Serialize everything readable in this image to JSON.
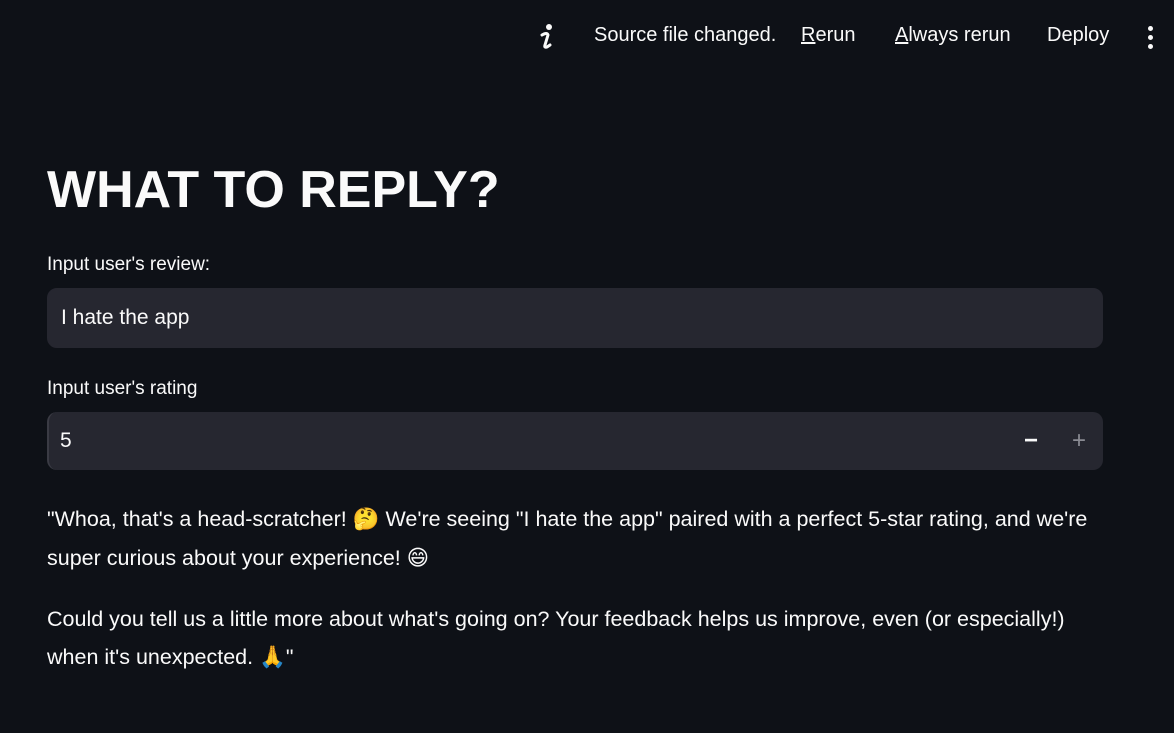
{
  "header": {
    "status_icon": "info-icon",
    "status_text": "Source file changed.",
    "rerun_accel": "R",
    "rerun_rest": "erun",
    "always_accel": "A",
    "always_rest": "lways rerun",
    "deploy_label": "Deploy",
    "menu_icon": "kebab-menu-icon"
  },
  "main": {
    "title": "WHAT TO REPLY?",
    "review_label": "Input user's review:",
    "review_value": "I hate the app",
    "rating_label": "Input user's rating",
    "rating_value": "5",
    "decrement_label": "−",
    "increment_label": "+",
    "reply": {
      "p1_part1": "\"Whoa, that's a head-scratcher! ",
      "p1_emoji1": "🤔",
      "p1_part2": " We're seeing \"I hate the app\" paired with a perfect 5-star rating, and we're super curious about your experience! ",
      "p1_emoji2": "😄",
      "p2_part1": "Could you tell us a little more about what's going on? Your feedback helps us improve, even (or especially!) when it's unexpected. ",
      "p2_emoji": "🙏",
      "p2_part2": "\""
    }
  },
  "colors": {
    "background": "#0e1117",
    "input_bg": "#262730",
    "text": "#fafafa"
  }
}
